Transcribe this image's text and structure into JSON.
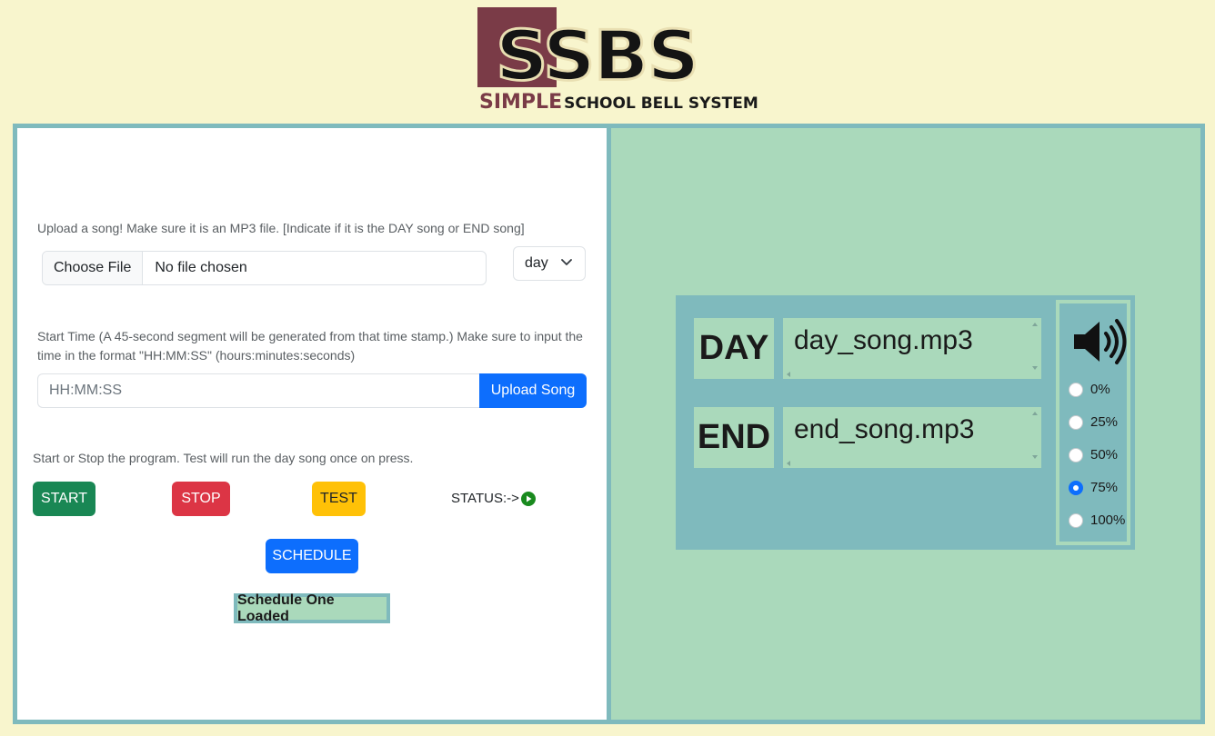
{
  "logo": {
    "letters": "SSBS",
    "tag_simple": "SIMPLE",
    "tag_rest": "SCHOOL BELL SYSTEM"
  },
  "upload": {
    "instruction": "Upload a song! Make sure it is an MP3 file. [Indicate if it is the DAY song or END song]",
    "choose_file_label": "Choose File",
    "file_status": "No file chosen",
    "song_type_selected": "day"
  },
  "start_time": {
    "instruction": "Start Time (A 45-second segment will be generated from that time stamp.) Make sure to input the time in the format \"HH:MM:SS\" (hours:minutes:seconds)",
    "placeholder": "HH:MM:SS",
    "upload_label": "Upload Song"
  },
  "controls": {
    "instruction": "Start or Stop the program. Test will run the day song once on press.",
    "start_label": "START",
    "stop_label": "STOP",
    "test_label": "TEST",
    "status_label": "STATUS:->",
    "schedule_label": "SCHEDULE",
    "schedule_loaded": "Schedule One Loaded"
  },
  "player": {
    "day_label": "DAY",
    "day_song": "day_song.mp3",
    "end_label": "END",
    "end_song": "end_song.mp3",
    "volume_options": [
      "0%",
      "25%",
      "50%",
      "75%",
      "100%"
    ],
    "volume_selected": "75%"
  },
  "colors": {
    "background": "#f8f5cd",
    "frame": "#7fbabd",
    "right_panel": "#aad9bb",
    "start": "#198754",
    "stop": "#dc3545",
    "test": "#ffc107",
    "primary": "#0d6efd",
    "brand": "#7a3b47"
  }
}
